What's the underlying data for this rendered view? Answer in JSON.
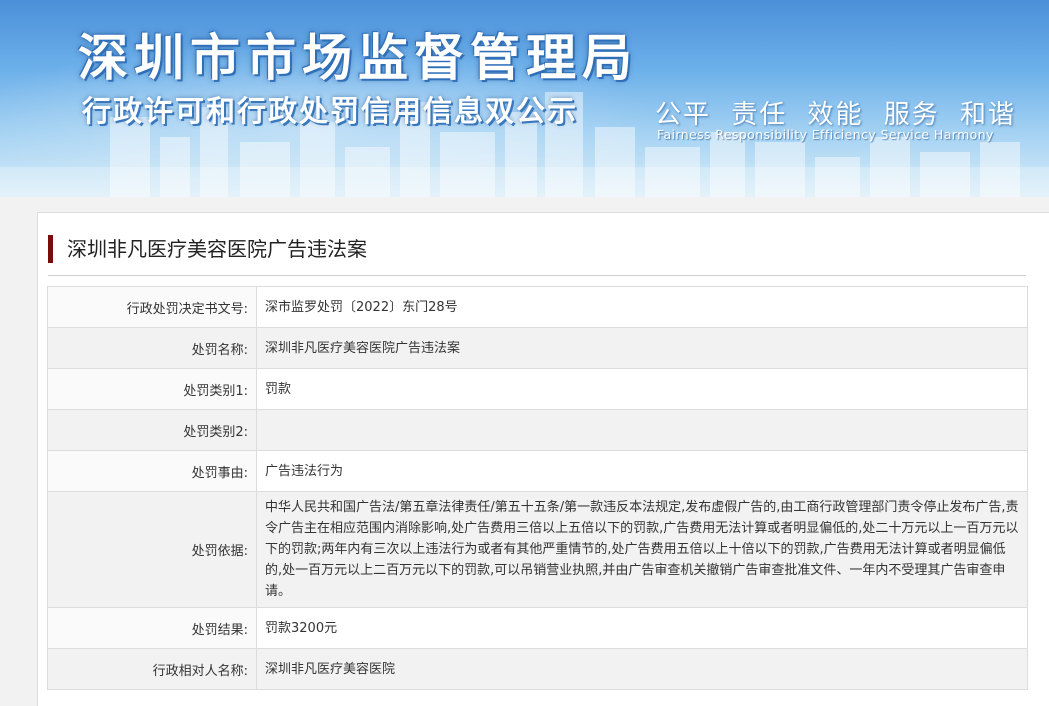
{
  "header": {
    "title": "深圳市市场监督管理局",
    "subtitle": "行政许可和行政处罚信用信息双公示",
    "slogan": "公平 责任 效能 服务 和谐",
    "slogan_en": "Fairness Responsibility Efficiency Service Harmony"
  },
  "case": {
    "title": "深圳非凡医疗美容医院广告违法案"
  },
  "rows": [
    {
      "label": "行政处罚决定书文号:",
      "value": "深市监罗处罚〔2022〕东门28号"
    },
    {
      "label": "处罚名称:",
      "value": "深圳非凡医疗美容医院广告违法案"
    },
    {
      "label": "处罚类别1:",
      "value": "罚款"
    },
    {
      "label": "处罚类别2:",
      "value": ""
    },
    {
      "label": "处罚事由:",
      "value": "广告违法行为"
    },
    {
      "label": "处罚依据:",
      "value": "中华人民共和国广告法/第五章法律责任/第五十五条/第一款违反本法规定,发布虚假广告的,由工商行政管理部门责令停止发布广告,责令广告主在相应范围内消除影响,处广告费用三倍以上五倍以下的罚款,广告费用无法计算或者明显偏低的,处二十万元以上一百万元以下的罚款;两年内有三次以上违法行为或者有其他严重情节的,处广告费用五倍以上十倍以下的罚款,广告费用无法计算或者明显偏低的,处一百万元以上二百万元以下的罚款,可以吊销营业执照,并由广告审查机关撤销广告审查批准文件、一年内不受理其广告审查申请。"
    },
    {
      "label": "处罚结果:",
      "value": "罚款3200元"
    },
    {
      "label": "行政相对人名称:",
      "value": "深圳非凡医疗美容医院"
    }
  ]
}
